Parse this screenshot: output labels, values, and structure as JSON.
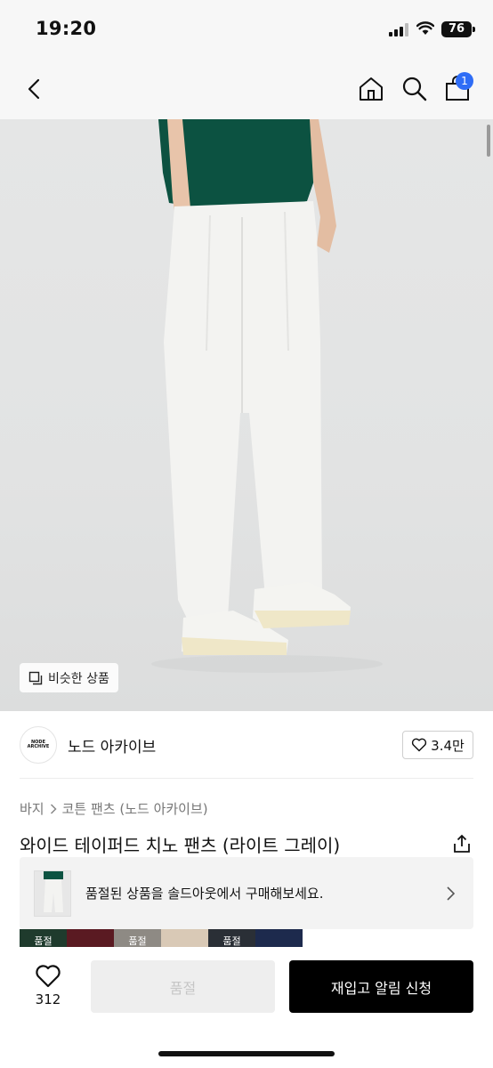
{
  "status": {
    "time": "19:20",
    "battery": "76"
  },
  "nav": {
    "back_icon": "chevron-left-icon",
    "home_icon": "home-icon",
    "search_icon": "search-icon",
    "cart_icon": "shopping-bag-icon",
    "cart_badge": "1"
  },
  "product_image": {
    "similar_label": "비슷한 상품"
  },
  "brand": {
    "logo_text": "NODE ARCHIVE",
    "name": "노드 아카이브",
    "likes": "3.4만"
  },
  "breadcrumb": [
    "바지",
    "코튼 팬츠 (노드 아카이브)"
  ],
  "product": {
    "title": "와이드 테이퍼드 치노 팬츠 (라이트 그레이)"
  },
  "soldout_banner": {
    "text": "품절된 상품을 솔드아웃에서 구매해보세요."
  },
  "swatches": [
    {
      "color": "#1f3b2d",
      "label": "품절"
    },
    {
      "color": "#5a1a22",
      "label": ""
    },
    {
      "color": "#8e8a84",
      "label": "품절"
    },
    {
      "color": "#d9c9b6",
      "label": ""
    },
    {
      "color": "#2a2f36",
      "label": "품절"
    },
    {
      "color": "#1d2a4d",
      "label": ""
    }
  ],
  "bottom": {
    "like_count": "312",
    "soldout_button": "품절",
    "restock_button": "재입고 알림 신청"
  },
  "colors": {
    "accent": "#2f6df6",
    "primary_button": "#000000",
    "disabled_button": "#eeeeee"
  }
}
